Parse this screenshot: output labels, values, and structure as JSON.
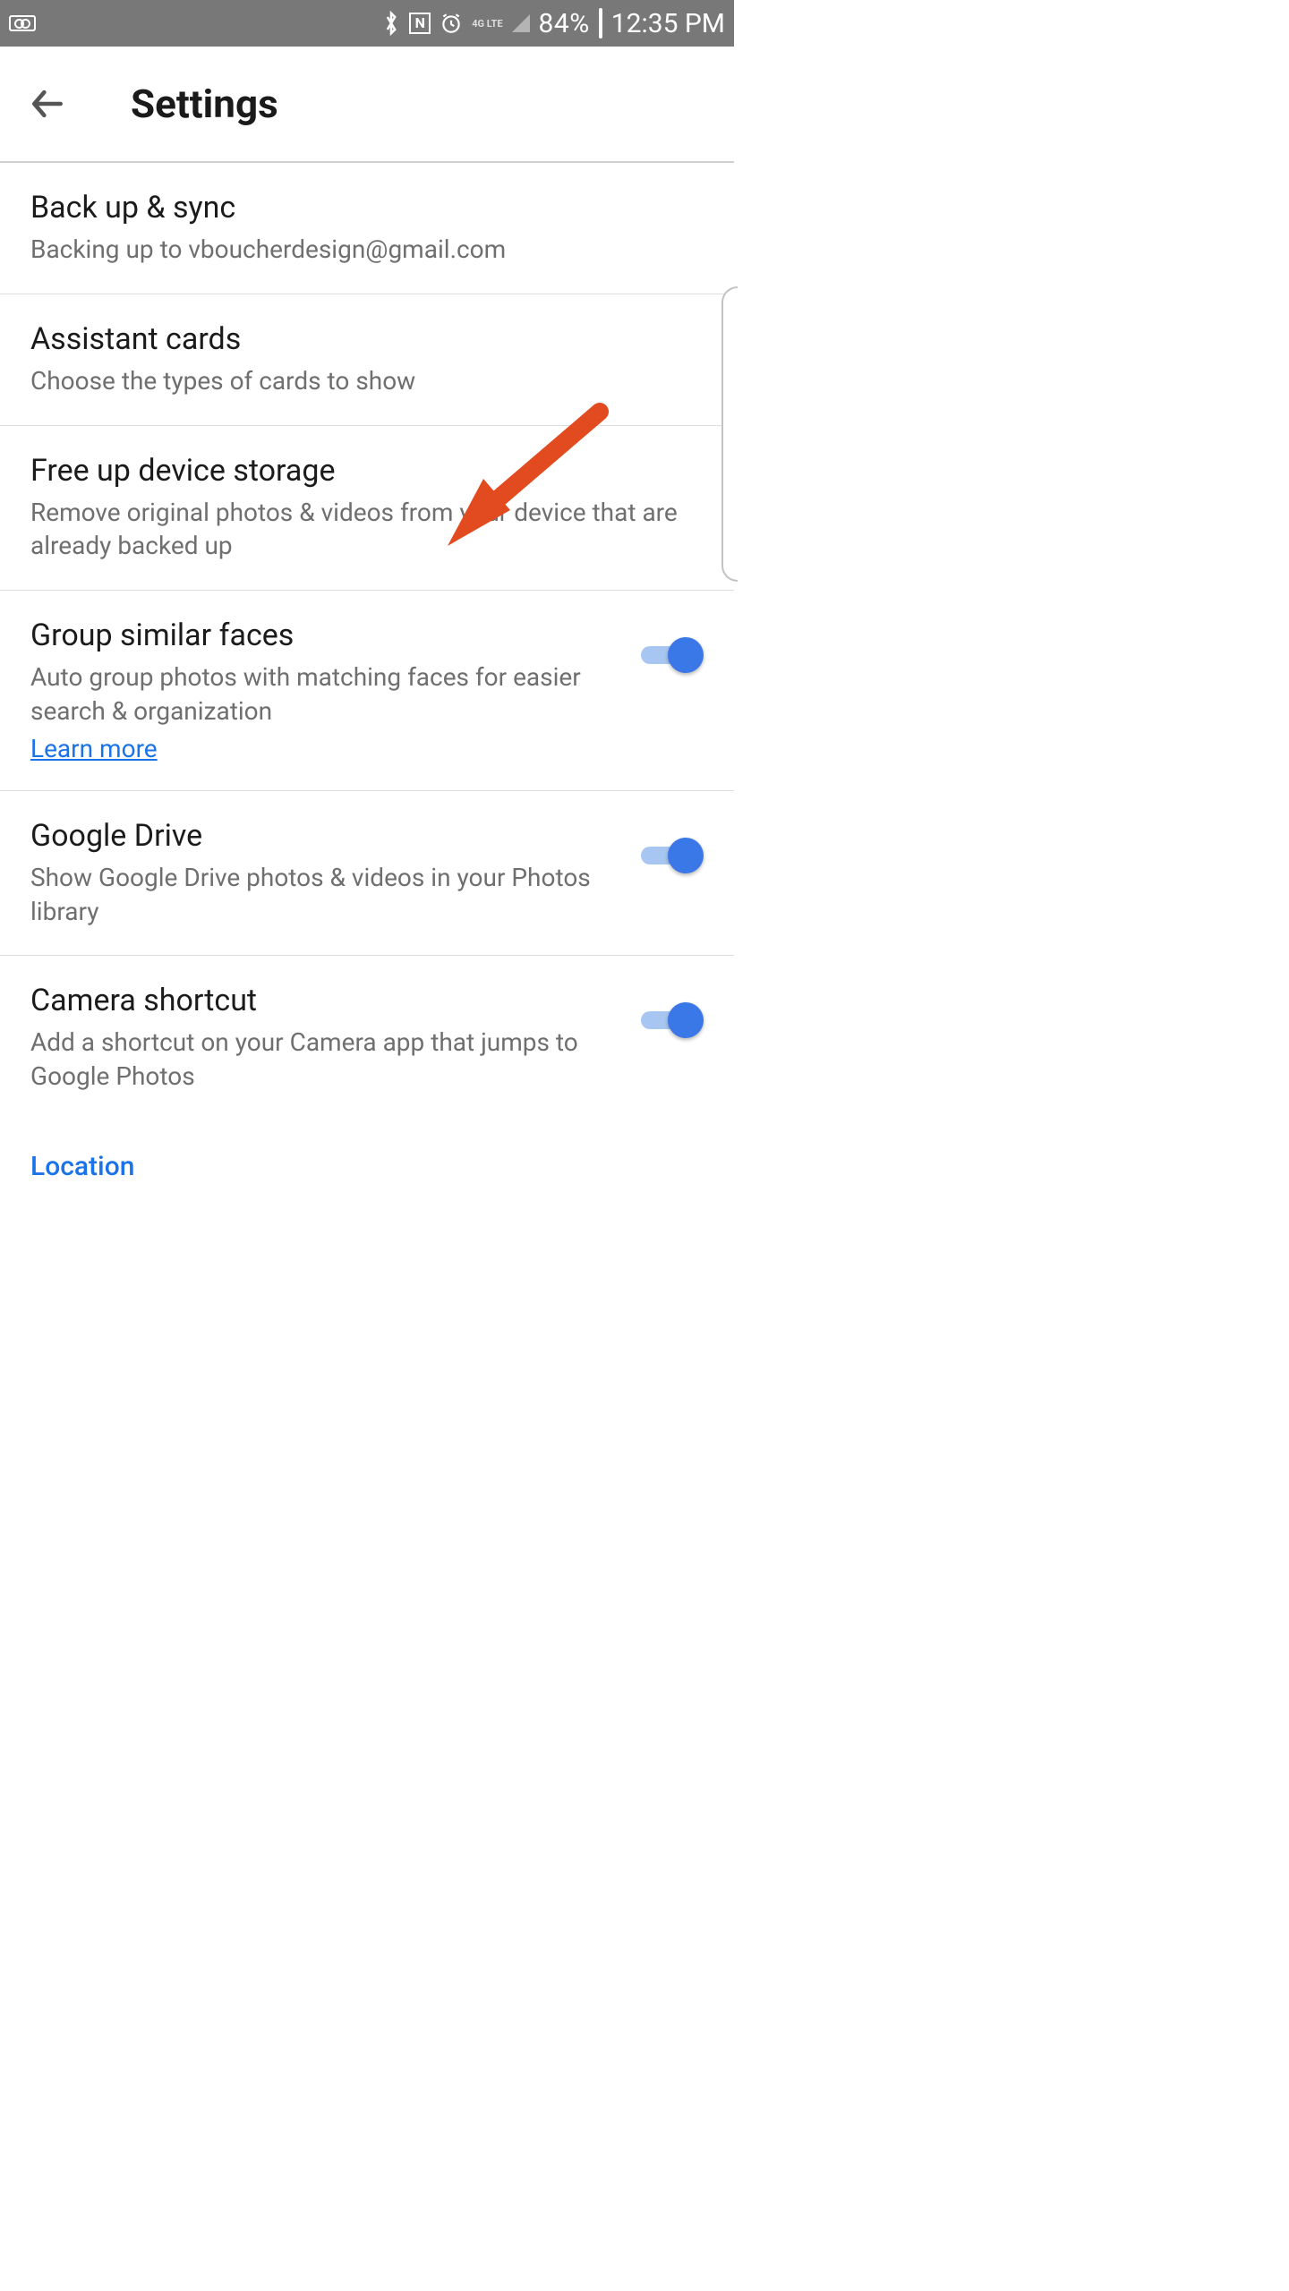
{
  "status_bar": {
    "battery_pct": "84%",
    "time": "12:35 PM",
    "network_label": "4G LTE"
  },
  "app_bar": {
    "title": "Settings"
  },
  "rows": {
    "backup": {
      "title": "Back up & sync",
      "sub": "Backing up to vboucherdesign@gmail.com"
    },
    "assistant": {
      "title": "Assistant cards",
      "sub": "Choose the types of cards to show"
    },
    "freeup": {
      "title": "Free up device storage",
      "sub": "Remove original photos & videos from your device that are already backed up"
    },
    "faces": {
      "title": "Group similar faces",
      "sub": "Auto group photos with matching faces for easier search & organization",
      "link": "Learn more"
    },
    "drive": {
      "title": "Google Drive",
      "sub": "Show Google Drive photos & videos in your Photos library"
    },
    "camera": {
      "title": "Camera shortcut",
      "sub": "Add a shortcut on your Camera app that jumps to Google Photos"
    }
  },
  "section": {
    "location": "Location"
  },
  "toggles": {
    "faces": true,
    "drive": true,
    "camera": true
  },
  "annotation": {
    "color": "#e24a1f"
  }
}
